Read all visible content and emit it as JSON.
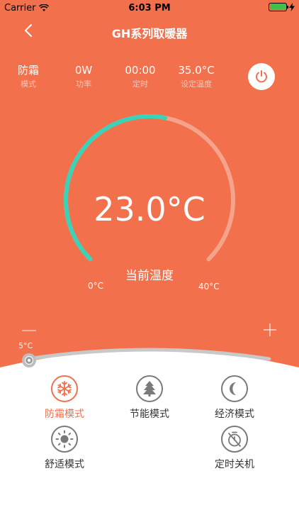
{
  "status_bar": {
    "carrier": "Carrier",
    "time": "6:03 PM"
  },
  "nav": {
    "title": "GH系列取暖器"
  },
  "stats": [
    {
      "value": "防霜",
      "label": "模式"
    },
    {
      "value": "0W",
      "label": "功率"
    },
    {
      "value": "00:00",
      "label": "定时"
    },
    {
      "value": "35.0°C",
      "label": "设定温度"
    }
  ],
  "gauge": {
    "current_temp": "23.0°C",
    "label": "当前温度",
    "min_label": "0°C",
    "max_label": "40°C",
    "min": 0,
    "max": 40,
    "current": 23,
    "track_color": "#f6a38c",
    "progress_color": "#3bd2b7"
  },
  "slider": {
    "value_label": "5°C",
    "value": 5
  },
  "modes": [
    {
      "label": "防霜模式",
      "icon": "snowflake-icon",
      "active": true
    },
    {
      "label": "节能模式",
      "icon": "tree-icon",
      "active": false
    },
    {
      "label": "经济模式",
      "icon": "moon-icon",
      "active": false
    },
    {
      "label": "舒适模式",
      "icon": "sun-icon",
      "active": false
    },
    {
      "label": "定时关机",
      "icon": "timer-off-icon",
      "active": false
    }
  ],
  "colors": {
    "accent": "#f2704c",
    "teal": "#3bd2b7",
    "white": "#ffffff"
  }
}
